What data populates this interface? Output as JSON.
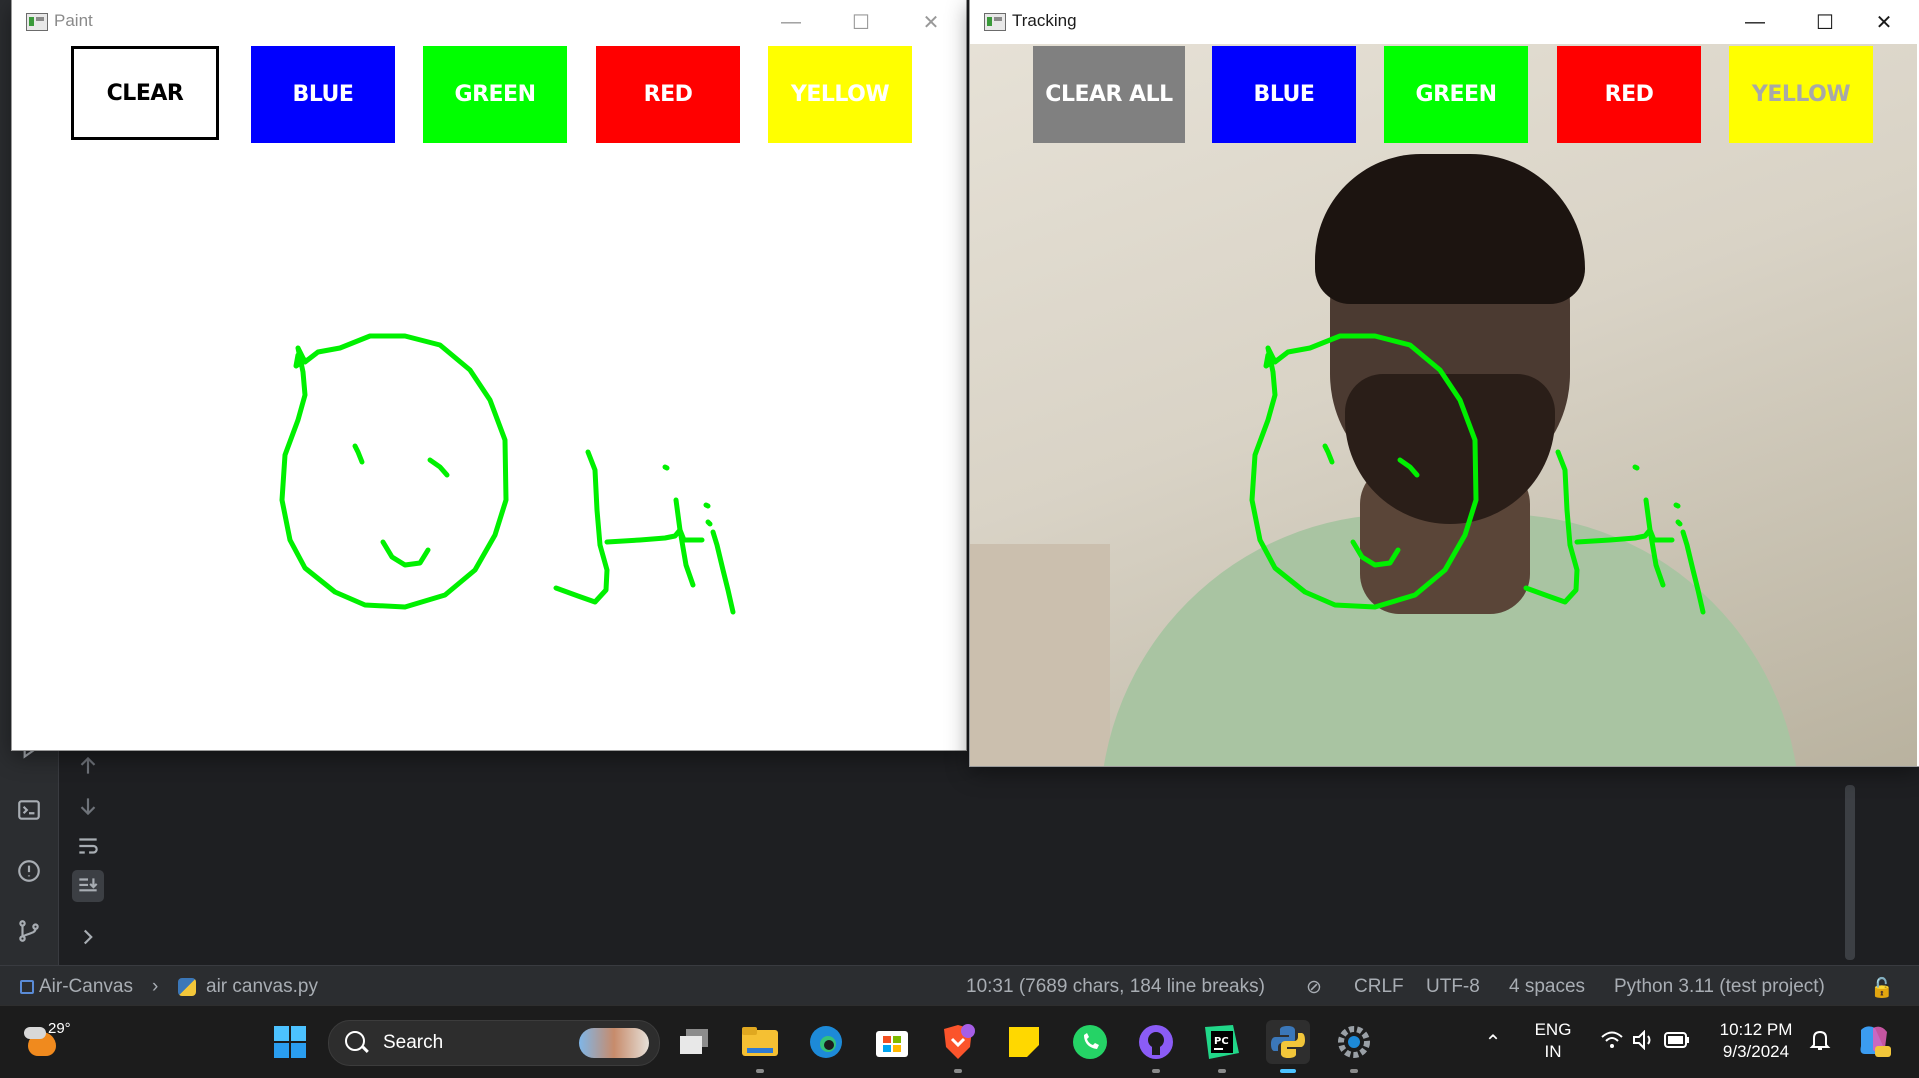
{
  "paint_window": {
    "title": "Paint",
    "buttons": [
      {
        "label": "CLEAR",
        "bg": "#ffffff",
        "fg": "#000000"
      },
      {
        "label": "BLUE",
        "bg": "#0000ff",
        "fg": "#ffffff"
      },
      {
        "label": "GREEN",
        "bg": "#00ff00",
        "fg": "#ffffff"
      },
      {
        "label": "RED",
        "bg": "#ff0000",
        "fg": "#ffffff"
      },
      {
        "label": "YELLOW",
        "bg": "#ffff00",
        "fg": "#ffffff"
      }
    ]
  },
  "tracking_window": {
    "title": "Tracking",
    "buttons": [
      {
        "label": "CLEAR ALL",
        "bg": "#808080",
        "fg": "#ffffff"
      },
      {
        "label": "BLUE",
        "bg": "#0000ff",
        "fg": "#ffffff"
      },
      {
        "label": "GREEN",
        "bg": "#00ff00",
        "fg": "#ffffff"
      },
      {
        "label": "RED",
        "bg": "#ff0000",
        "fg": "#ffffff"
      },
      {
        "label": "YELLOW",
        "bg": "#ffff00",
        "fg": "#a8a8a8"
      }
    ]
  },
  "stroke_color": "#00f000",
  "status_bar": {
    "project": "Air-Canvas",
    "file": "air canvas.py",
    "position": "10:31 (7689 chars, 184 line breaks)",
    "line_ending": "CRLF",
    "encoding": "UTF-8",
    "indent": "4 spaces",
    "interpreter": "Python 3.11 (test project)"
  },
  "taskbar": {
    "weather_temp": "29°",
    "search_placeholder": "Search",
    "language_line1": "ENG",
    "language_line2": "IN",
    "time": "10:12 PM",
    "date": "9/3/2024",
    "pinned_apps": [
      "start",
      "task-view",
      "file-explorer",
      "edge",
      "microsoft-store",
      "brave",
      "sticky-notes",
      "whatsapp",
      "github-desktop",
      "pycharm",
      "python",
      "settings"
    ]
  }
}
